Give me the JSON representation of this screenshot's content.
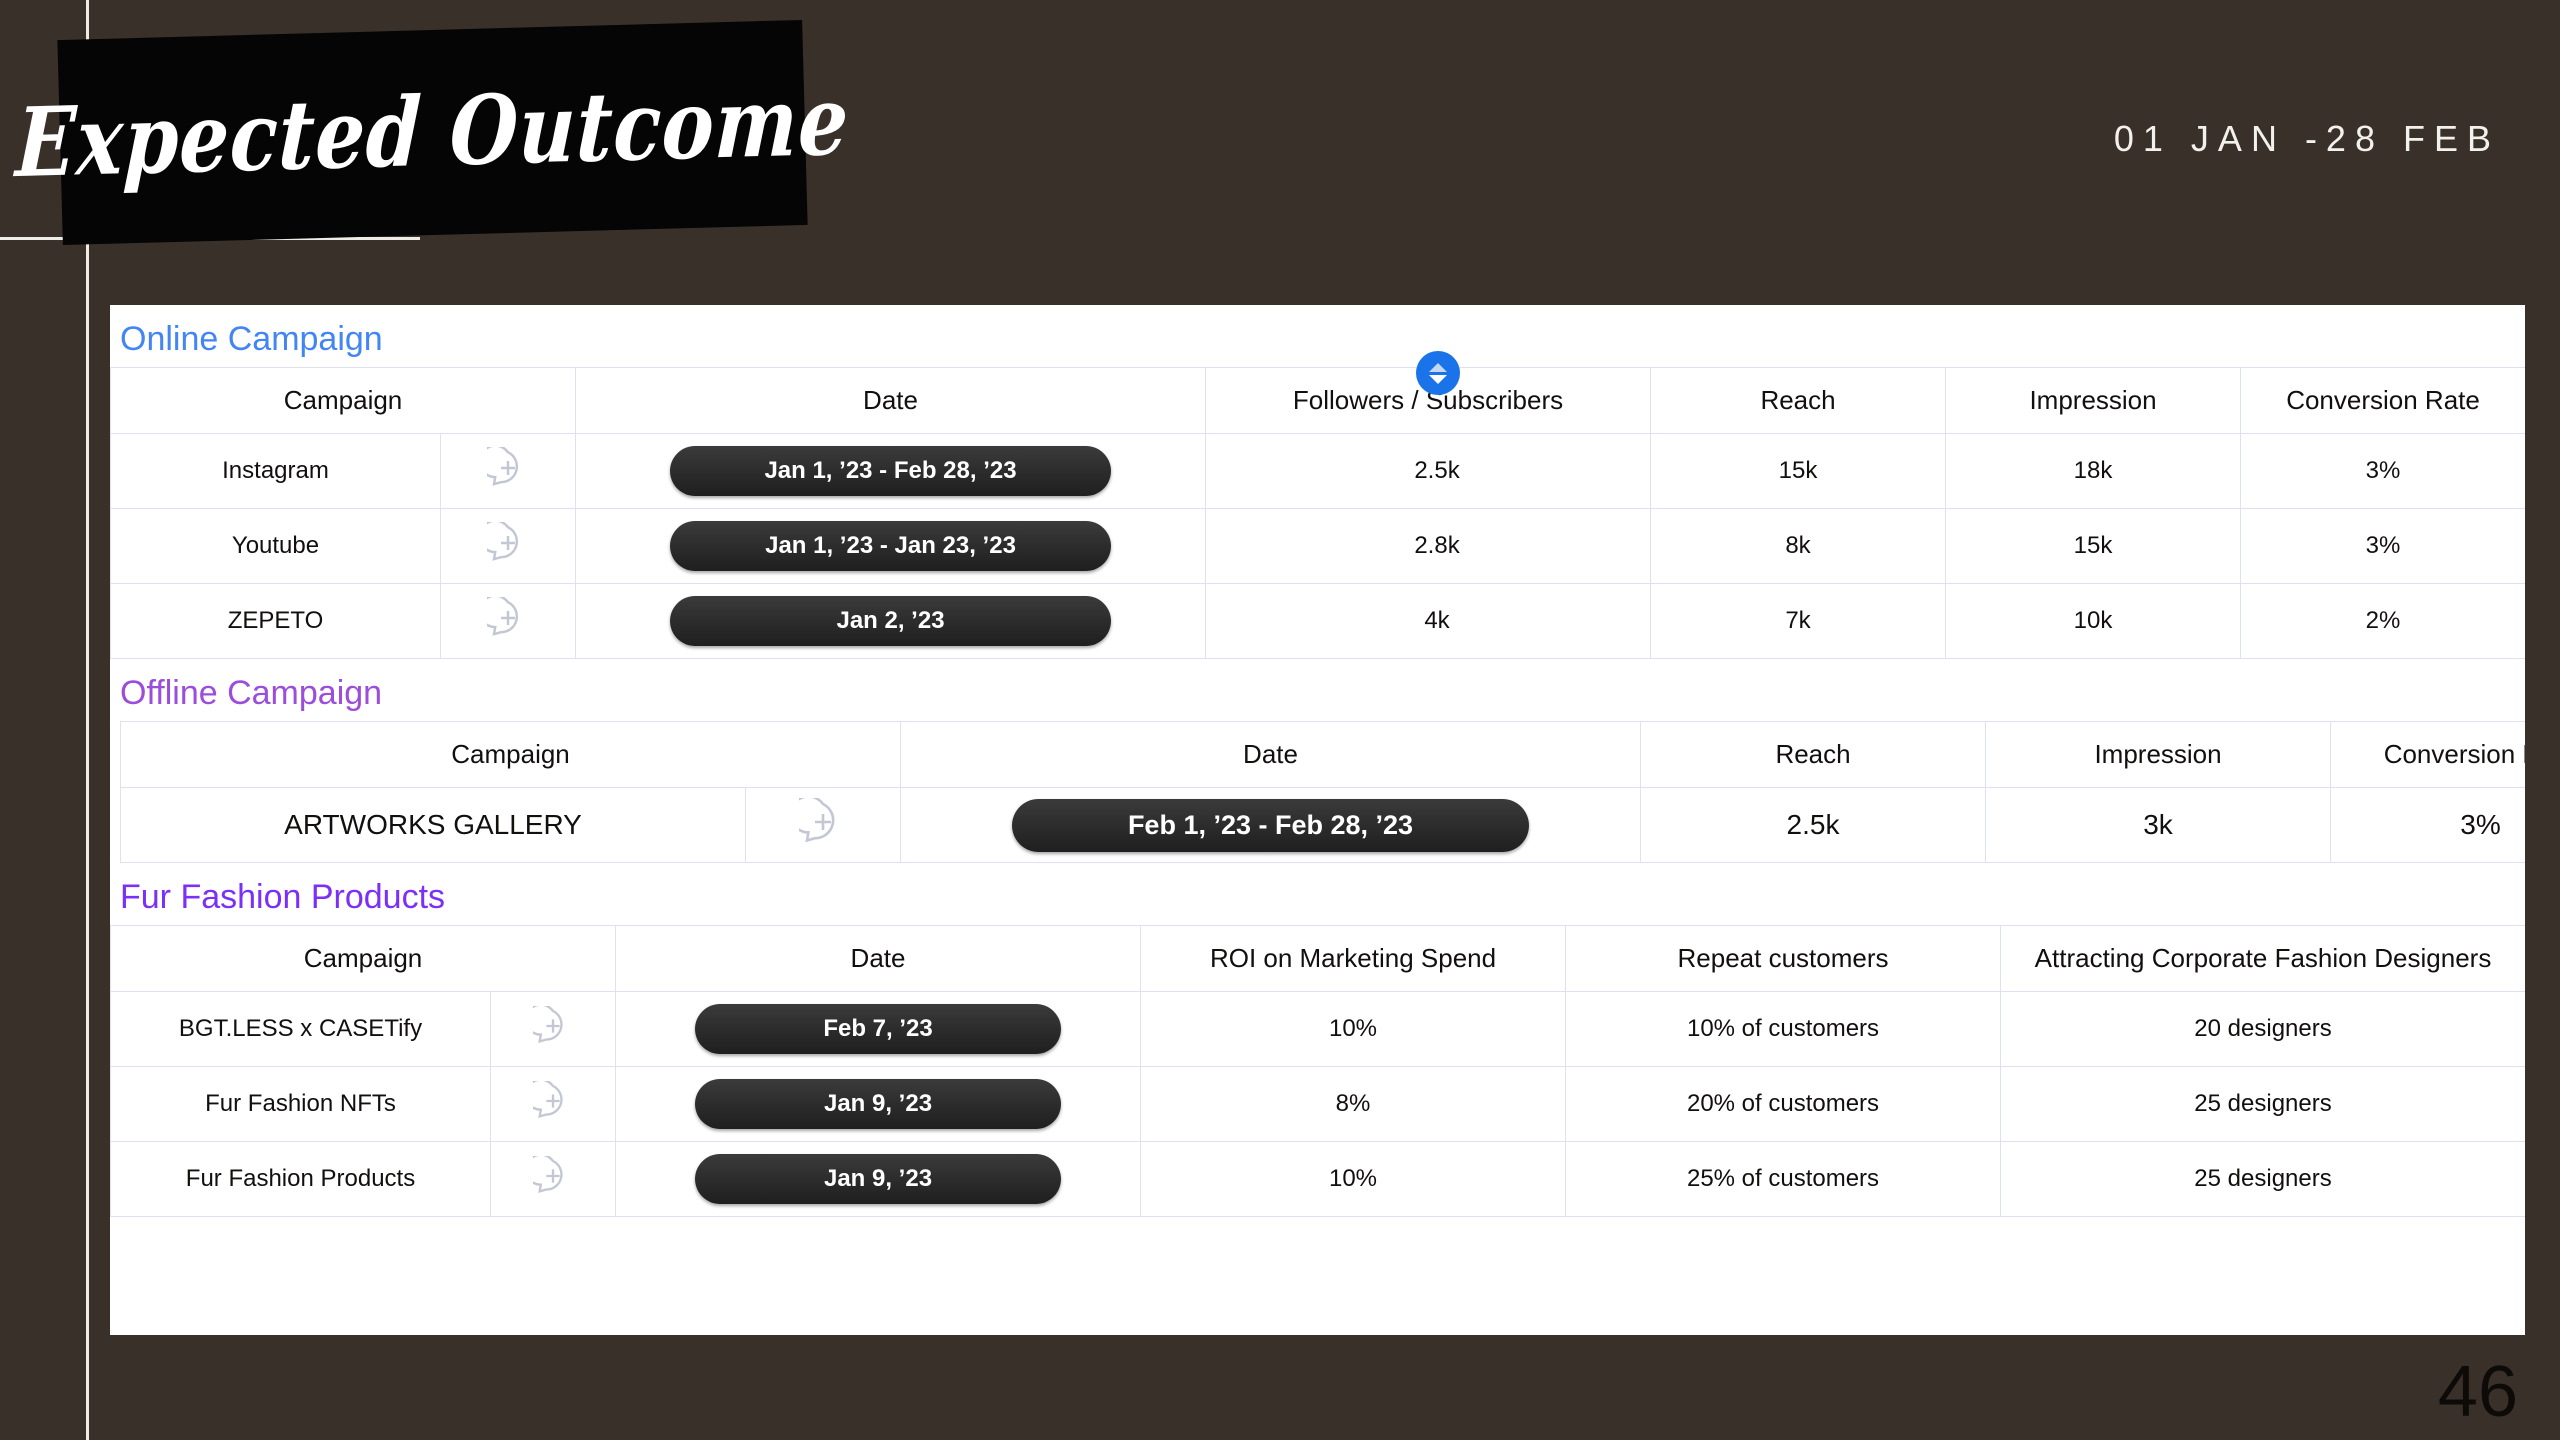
{
  "slide": {
    "title": "Expected Outcome",
    "date_range": "01 JAN  -28 FEB",
    "page_number": "46",
    "background_color": "#393029",
    "title_box_color": "#050505"
  },
  "icons": {
    "add_comment": "add-comment-icon",
    "sort_handle": "sort-updown-icon"
  },
  "sections": [
    {
      "heading": "Online Campaign",
      "heading_color": "#4285f4",
      "columns": [
        "Campaign",
        "Date",
        "Followers / Subscribers",
        "Reach",
        "Impression",
        "Conversion Rate"
      ],
      "rows": [
        {
          "campaign": "Instagram",
          "date": "Jan 1, ’23 - Feb 28, ’23",
          "followers": "2.5k",
          "reach": "15k",
          "impression": "18k",
          "conversion": "3%"
        },
        {
          "campaign": "Youtube",
          "date": "Jan 1, ’23 - Jan 23, ’23",
          "followers": "2.8k",
          "reach": "8k",
          "impression": "15k",
          "conversion": "3%"
        },
        {
          "campaign": "ZEPETO",
          "date": "Jan 2, ’23",
          "followers": "4k",
          "reach": "7k",
          "impression": "10k",
          "conversion": "2%"
        }
      ]
    },
    {
      "heading": "Offline Campaign",
      "heading_color": "#9b4ddb",
      "columns": [
        "Campaign",
        "Date",
        "Reach",
        "Impression",
        "Conversion Rate"
      ],
      "rows": [
        {
          "campaign": "ARTWORKS GALLERY",
          "date": "Feb 1, ’23 - Feb 28, ’23",
          "reach": "2.5k",
          "impression": "3k",
          "conversion": "3%"
        }
      ]
    },
    {
      "heading": "Fur Fashion Products",
      "heading_color": "#7b2ff7",
      "columns": [
        "Campaign",
        "Date",
        "ROI on Marketing Spend",
        "Repeat customers",
        "Attracting Corporate Fashion Designers"
      ],
      "rows": [
        {
          "campaign": "BGT.LESS x CASETify",
          "date": "Feb 7, ’23",
          "roi": "10%",
          "repeat": "10% of customers",
          "designers": "20 designers"
        },
        {
          "campaign": "Fur Fashion NFTs",
          "date": "Jan 9, ’23",
          "roi": "8%",
          "repeat": "20% of customers",
          "designers": "25 designers"
        },
        {
          "campaign": "Fur Fashion Products",
          "date": "Jan 9, ’23",
          "roi": "10%",
          "repeat": "25% of customers",
          "designers": "25 designers"
        }
      ]
    }
  ]
}
